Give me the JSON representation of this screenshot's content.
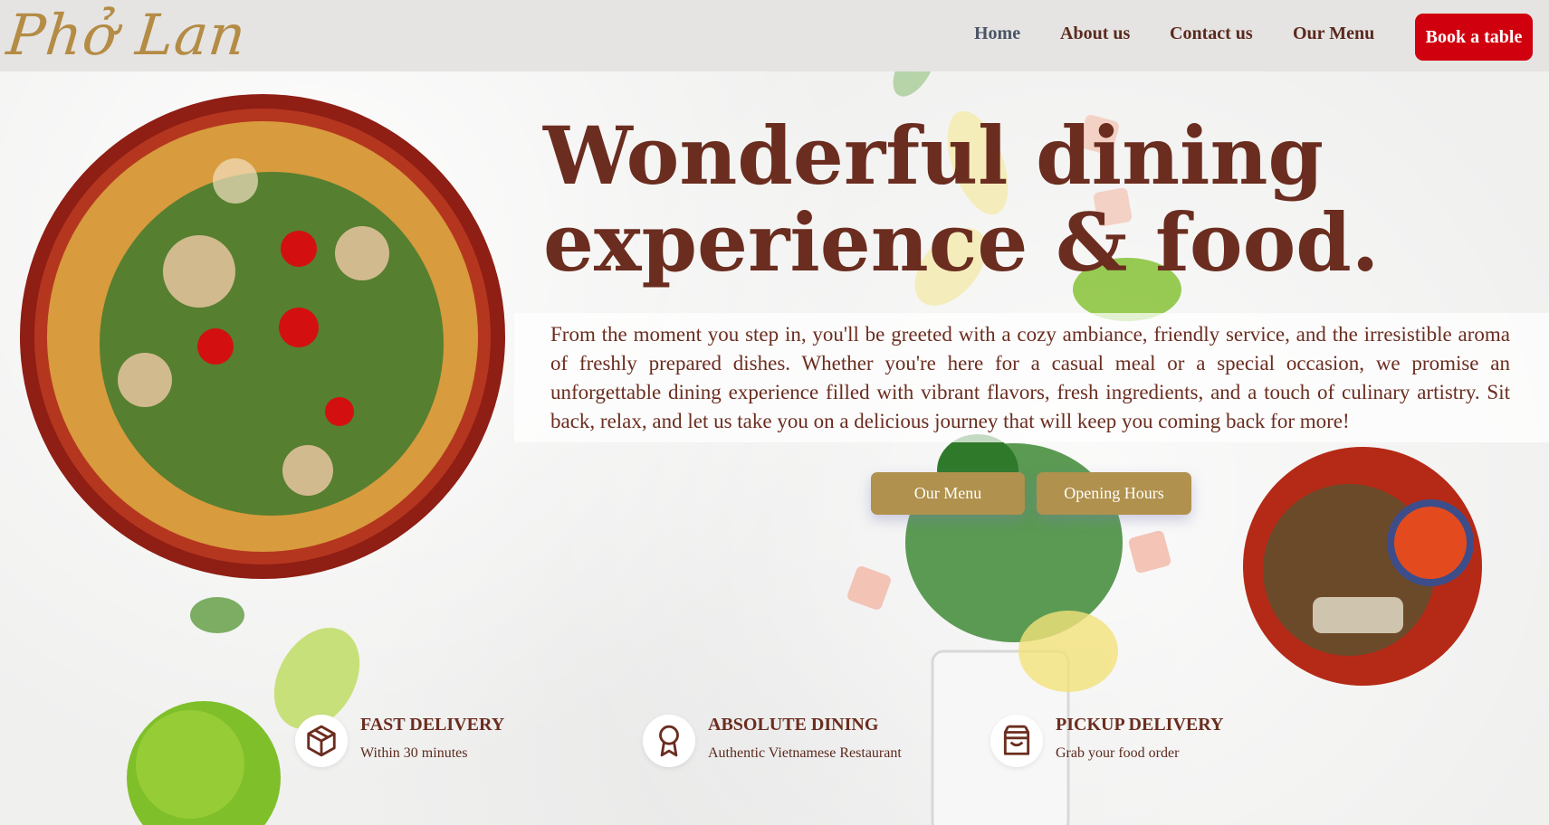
{
  "brand": {
    "logo_text": "Phở Lan"
  },
  "nav": {
    "items": [
      "Home",
      "About us",
      "Contact us",
      "Our Menu"
    ],
    "cta": "Book a table"
  },
  "hero": {
    "title_line1": "Wonderful dining",
    "title_line2": "experience & food.",
    "description": "From the moment you step in, you'll be greeted with a cozy ambiance, friendly service, and the irresistible aroma of freshly prepared dishes. Whether you're here for a casual meal or a special occasion, we promise an unforgettable dining experience filled with vibrant flavors, fresh ingredients, and a touch of culinary artistry. Sit back, relax, and let us take you on a delicious journey that will keep you coming back for more!",
    "buttons": [
      "Our Menu",
      "Opening Hours"
    ]
  },
  "features": [
    {
      "icon": "box-icon",
      "title": "FAST DELIVERY",
      "subtitle": "Within 30 minutes"
    },
    {
      "icon": "award-icon",
      "title": "ABSOLUTE DINING",
      "subtitle": "Authentic Vietnamese Restaurant"
    },
    {
      "icon": "shopping-bag-icon",
      "title": "PICKUP DELIVERY",
      "subtitle": "Grab your food order"
    }
  ],
  "colors": {
    "brand_gold": "#b48c45",
    "heading_brown": "#6b2d1f",
    "cta_red": "#d0000e",
    "button_gold": "#b0914d"
  }
}
